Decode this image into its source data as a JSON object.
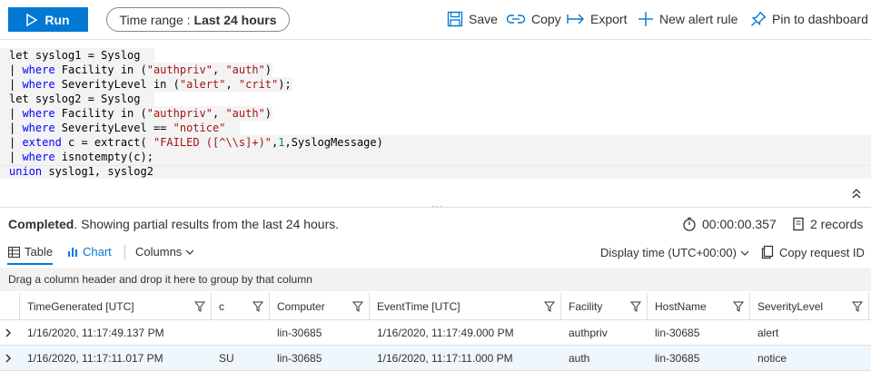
{
  "toolbar": {
    "run_label": "Run",
    "time_range_prefix": "Time range :",
    "time_range_value": "Last 24 hours",
    "save_label": "Save",
    "copy_label": "Copy",
    "export_label": "Export",
    "new_alert_label": "New alert rule",
    "pin_label": "Pin to dashboard"
  },
  "query": {
    "l1": "let syslog1 = Syslog",
    "l2_pipe": "| ",
    "l2_kw": "where",
    "l2_a": " Facility ",
    "l2_in": "in",
    "l2_b": " (",
    "l2_s1": "\"authpriv\"",
    "l2_c": ", ",
    "l2_s2": "\"auth\"",
    "l2_d": ")",
    "l3_pipe": "| ",
    "l3_kw": "where",
    "l3_a": " SeverityLevel ",
    "l3_in": "in",
    "l3_b": " (",
    "l3_s1": "\"alert\"",
    "l3_c": ", ",
    "l3_s2": "\"crit\"",
    "l3_d": ");",
    "l4": "let syslog2 = Syslog",
    "l5_pipe": "| ",
    "l5_kw": "where",
    "l5_a": " Facility ",
    "l5_in": "in",
    "l5_b": " (",
    "l5_s1": "\"authpriv\"",
    "l5_c": ", ",
    "l5_s2": "\"auth\"",
    "l5_d": ")",
    "l6_pipe": "| ",
    "l6_kw": "where",
    "l6_a": " SeverityLevel == ",
    "l6_s1": "\"notice\"",
    "l7_pipe": "| ",
    "l7_kw": "extend",
    "l7_a": " c = extract( ",
    "l7_s1": "\"FAILED ([^\\\\s]+)\"",
    "l7_b": ",",
    "l7_n": "1",
    "l7_c": ",SyslogMessage)",
    "l8_pipe": "| ",
    "l8_kw": "where",
    "l8_a": " isnotempty(c);",
    "l9_kw": "union",
    "l9_a": " syslog1, syslog2"
  },
  "status": {
    "completed": "Completed",
    "message": ". Showing partial results from the last 24 hours.",
    "elapsed": "00:00:00.357",
    "records": "2 records"
  },
  "results_bar": {
    "table_tab": "Table",
    "chart_tab": "Chart",
    "columns_label": "Columns",
    "display_time": "Display time (UTC+00:00)",
    "copy_request": "Copy request ID"
  },
  "groupby_hint": "Drag a column header and drop it here to group by that column",
  "grid": {
    "columns": [
      "TimeGenerated [UTC]",
      "c",
      "Computer",
      "EventTime [UTC]",
      "Facility",
      "HostName",
      "SeverityLevel"
    ],
    "rows": [
      [
        "1/16/2020, 11:17:49.137 PM",
        "",
        "lin-30685",
        "1/16/2020, 11:17:49.000 PM",
        "authpriv",
        "lin-30685",
        "alert"
      ],
      [
        "1/16/2020, 11:17:11.017 PM",
        "SU",
        "lin-30685",
        "1/16/2020, 11:17:11.000 PM",
        "auth",
        "lin-30685",
        "notice"
      ]
    ]
  },
  "colors": {
    "accent": "#0078d4",
    "keyword": "#0000ff",
    "string": "#a31515",
    "number": "#098658"
  }
}
